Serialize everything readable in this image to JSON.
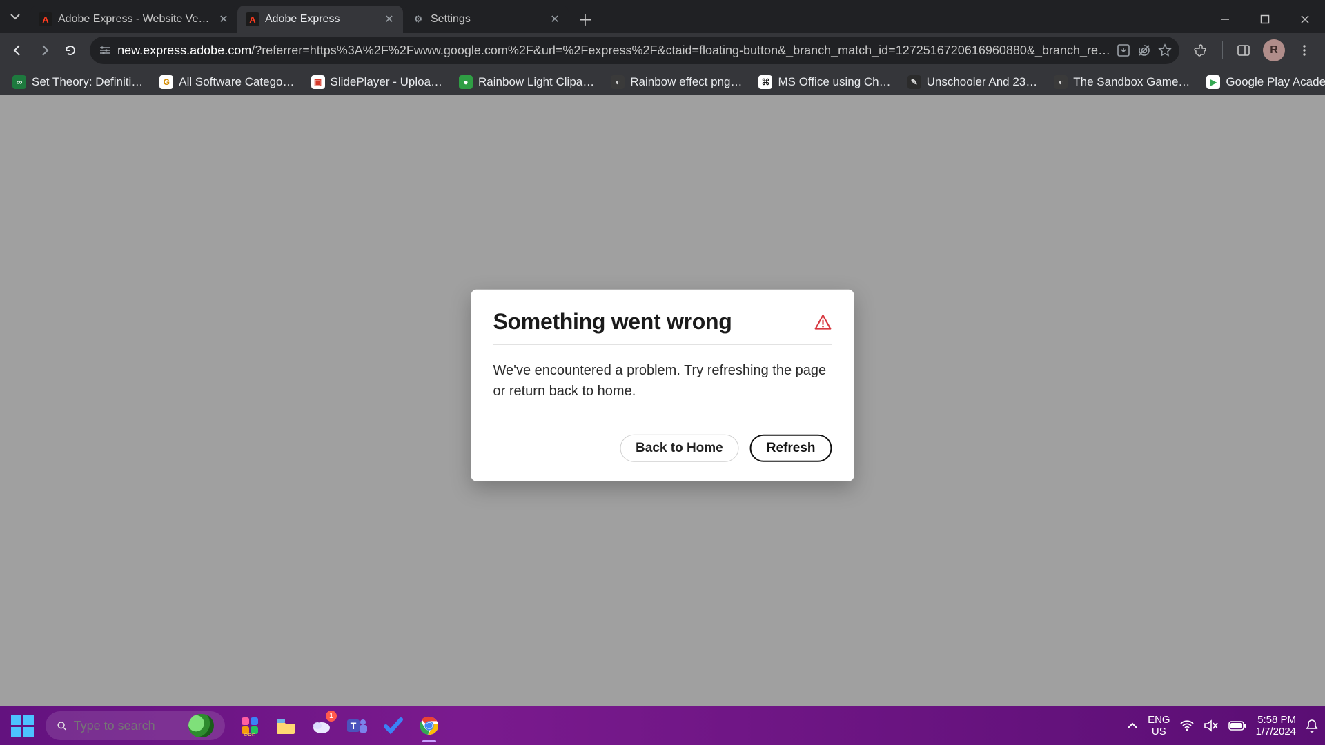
{
  "chrome": {
    "tabs": [
      {
        "title": "Adobe Express - Website Versio",
        "favicon_bg": "#1b1b1b",
        "favicon_fg": "#ff3b1f",
        "favicon_text": "A",
        "active": false
      },
      {
        "title": "Adobe Express",
        "favicon_bg": "#1b1b1b",
        "favicon_fg": "#ff3b1f",
        "favicon_text": "A",
        "active": true
      },
      {
        "title": "Settings",
        "favicon_bg": "transparent",
        "favicon_fg": "#9aa0a6",
        "favicon_text": "⚙",
        "active": false
      }
    ],
    "url_host": "new.express.adobe.com",
    "url_rest": "/?referrer=https%3A%2F%2Fwww.google.com%2F&url=%2Fexpress%2F&ctaid=floating-button&_branch_match_id=1272516720616960880&_branch_re…",
    "avatar_initial": "R"
  },
  "bookmarks": [
    {
      "label": "Set Theory: Definiti…",
      "icon_bg": "#1e7a3e",
      "icon_fg": "#fff",
      "icon_text": "∞"
    },
    {
      "label": "All Software Catego…",
      "icon_bg": "#ffffff",
      "icon_fg": "#d38b00",
      "icon_text": "G"
    },
    {
      "label": "SlidePlayer - Uploa…",
      "icon_bg": "#ffffff",
      "icon_fg": "#d53a2b",
      "icon_text": "▣"
    },
    {
      "label": "Rainbow Light Clipa…",
      "icon_bg": "#2f9e44",
      "icon_fg": "#fff",
      "icon_text": "●"
    },
    {
      "label": "Rainbow effect png…",
      "icon_bg": "#3a3a3a",
      "icon_fg": "#cfcfcf",
      "icon_text": "◐"
    },
    {
      "label": "MS Office using Ch…",
      "icon_bg": "#ffffff",
      "icon_fg": "#1b1b1b",
      "icon_text": "⌘"
    },
    {
      "label": "Unschooler And 23…",
      "icon_bg": "#2b2b2b",
      "icon_fg": "#dcdcdc",
      "icon_text": "✎"
    },
    {
      "label": "The Sandbox Game…",
      "icon_bg": "#3a3a3a",
      "icon_fg": "#cfcfcf",
      "icon_text": "◐"
    },
    {
      "label": "Google Play Acade…",
      "icon_bg": "#ffffff",
      "icon_fg": "#34a853",
      "icon_text": "▶"
    }
  ],
  "dialog": {
    "title": "Something went wrong",
    "body": "We've encountered a problem. Try refreshing the page or return back to home.",
    "back_label": "Back to Home",
    "refresh_label": "Refresh",
    "warn_color": "#d7373f"
  },
  "taskbar": {
    "search_placeholder": "Type to search",
    "lang_line1": "ENG",
    "lang_line2": "US",
    "time": "5:58 PM",
    "date": "1/7/2024",
    "weather_badge": "1"
  }
}
